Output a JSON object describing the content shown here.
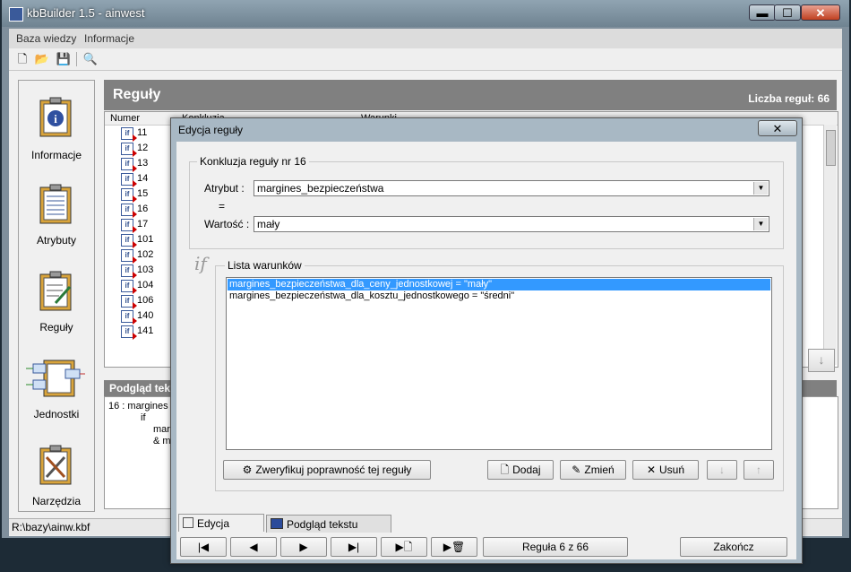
{
  "window": {
    "title": "kbBuilder 1.5 - ainwest",
    "min": "▬",
    "max": "☐",
    "close": "✕"
  },
  "menu": [
    "Baza wiedzy",
    "Informacje"
  ],
  "sidebar": [
    {
      "label": "Informacje",
      "icon": "info-clipboard-icon"
    },
    {
      "label": "Atrybuty",
      "icon": "attributes-clipboard-icon"
    },
    {
      "label": "Reguły",
      "icon": "rules-clipboard-icon"
    },
    {
      "label": "Jednostki",
      "icon": "units-diagram-icon"
    },
    {
      "label": "Narzędzia",
      "icon": "tools-icon"
    }
  ],
  "rules_panel": {
    "title": "Reguły",
    "count_label": "Liczba reguł: 66",
    "col_number": "Numer",
    "col_conclusion": "Konkluzja",
    "col_conditions": "Warunki"
  },
  "rule_numbers": [
    "11",
    "12",
    "13",
    "14",
    "15",
    "16",
    "17",
    "101",
    "102",
    "103",
    "104",
    "106",
    "140",
    "141"
  ],
  "preview": {
    "title": "Podgląd tek",
    "line1": "16   : margines",
    "line2": "if",
    "line3": "marg",
    "line4": "& ma"
  },
  "status": {
    "path": "R:\\bazy\\ainw.kbf"
  },
  "dialog": {
    "title": "Edycja reguły",
    "close": "✕",
    "conclusion_legend": "Konkluzja reguły nr  16",
    "attribute_label": "Atrybut :",
    "attribute_value": "margines_bezpieczeństwa",
    "equals": "=",
    "value_label": "Wartość :",
    "value_value": "mały",
    "if_symbol": "if",
    "conditions_legend": "Lista warunków",
    "conditions": [
      "margines_bezpieczeństwa_dla_ceny_jednostkowej = \"mały\"",
      "margines_bezpieczeństwa_dla_kosztu_jednostkowego = \"średni\""
    ],
    "btn_verify": "Zweryfikuj poprawność tej reguły",
    "btn_add": "Dodaj",
    "btn_change": "Zmień",
    "btn_delete": "Usuń",
    "tab_edit": "Edycja reguły",
    "tab_preview": "Podgląd tekstu reguły",
    "rule_position": "Reguła 6 z 66",
    "btn_finish": "Zakończ"
  }
}
